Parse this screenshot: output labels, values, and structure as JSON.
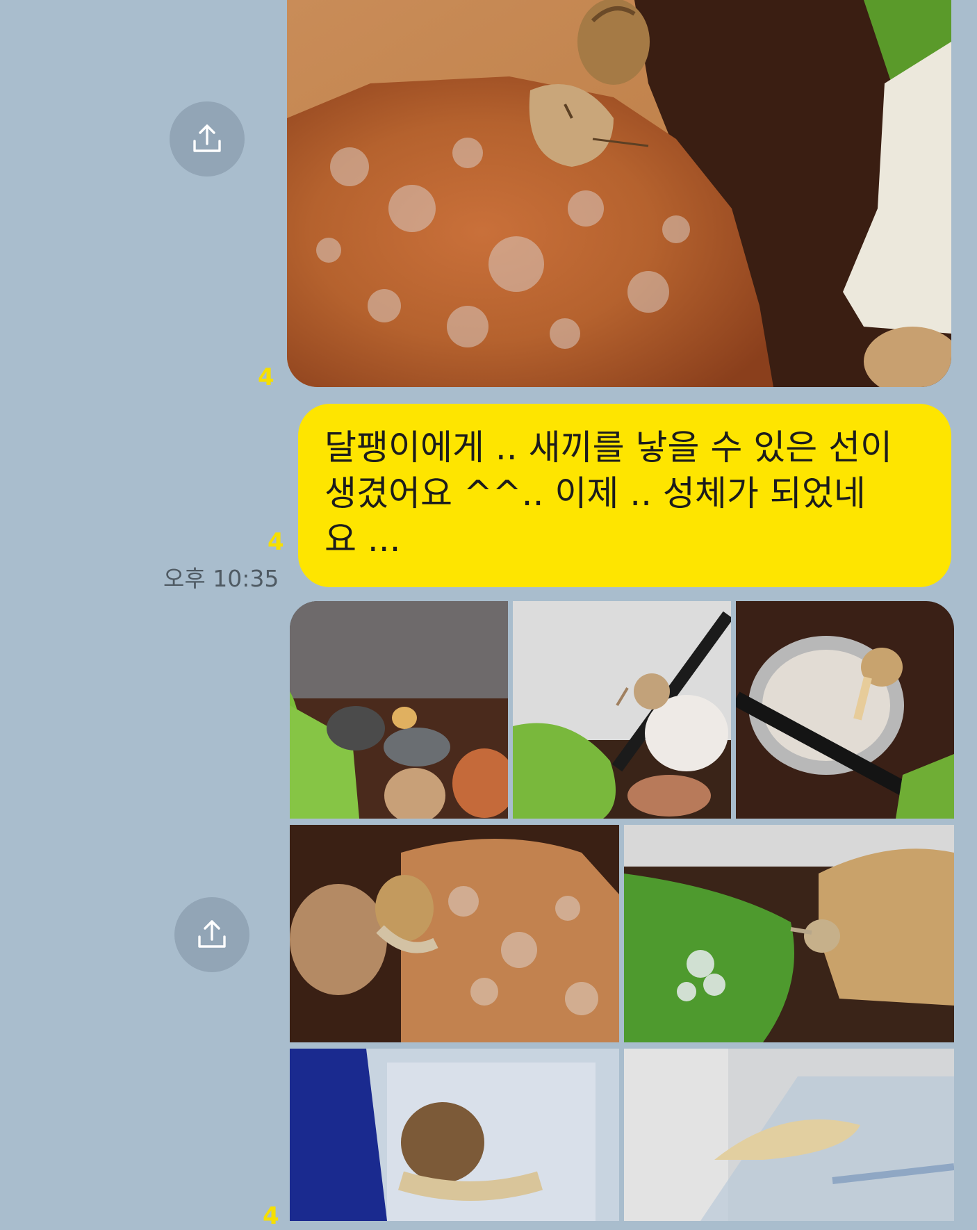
{
  "messages": [
    {
      "type": "photo",
      "unread": "4",
      "share_icon": "share-icon",
      "alt": ""
    },
    {
      "type": "text",
      "unread": "4",
      "time": "오후 10:35",
      "text": "달팽이에게 .. 새끼를 낳을 수 있은 선이\n생겼어요 ^^.. 이제 .. 성체가 되었네\n요 ..."
    },
    {
      "type": "photo-album",
      "unread": "4",
      "share_icon": "share-icon",
      "photo_count": 7
    }
  ],
  "colors": {
    "background": "#a9bdcd",
    "bubble": "#fee500",
    "unread": "#f6df00",
    "share_button": "#92a5b6"
  }
}
